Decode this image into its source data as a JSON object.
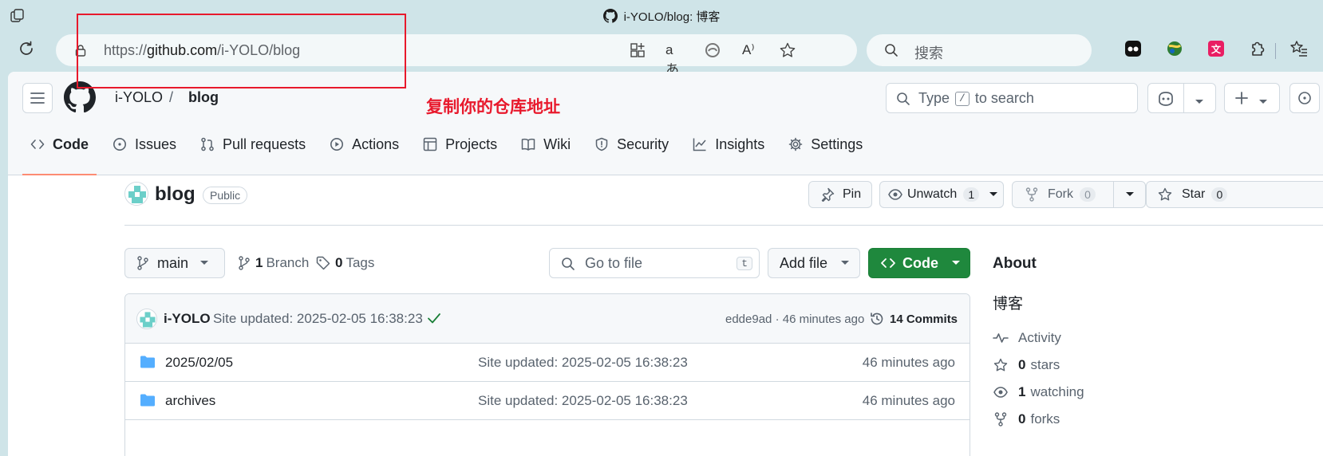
{
  "browser": {
    "window_title": "i-YOLO/blog: 博客",
    "url_prefix": "https://",
    "url_host": "github.com",
    "url_path": "/i-YOLO/blog",
    "search_placeholder": "搜索"
  },
  "annotation": {
    "text": "复制你的仓库地址",
    "color": "#e8192c"
  },
  "header": {
    "owner": "i-YOLO",
    "separator": "/",
    "repo": "blog",
    "search_prefix": "Type",
    "search_key": "/",
    "search_suffix": "to search"
  },
  "nav": {
    "tabs": [
      {
        "label": "Code",
        "icon": "code-icon"
      },
      {
        "label": "Issues",
        "icon": "issue-icon"
      },
      {
        "label": "Pull requests",
        "icon": "pull-request-icon"
      },
      {
        "label": "Actions",
        "icon": "play-icon"
      },
      {
        "label": "Projects",
        "icon": "table-icon"
      },
      {
        "label": "Wiki",
        "icon": "book-icon"
      },
      {
        "label": "Security",
        "icon": "shield-icon"
      },
      {
        "label": "Insights",
        "icon": "graph-icon"
      },
      {
        "label": "Settings",
        "icon": "gear-icon"
      }
    ],
    "active": "Code"
  },
  "repo": {
    "name": "blog",
    "visibility": "Public",
    "pin_label": "Pin",
    "unwatch_label": "Unwatch",
    "watch_count": "1",
    "fork_label": "Fork",
    "fork_count": "0",
    "star_label": "Star",
    "star_count": "0"
  },
  "files": {
    "branch": "main",
    "branch_count": "1",
    "branch_label": "Branch",
    "tag_count": "0",
    "tag_label": "Tags",
    "goto_placeholder": "Go to file",
    "goto_key": "t",
    "add_file_label": "Add file",
    "code_label": "Code",
    "commit": {
      "author": "i-YOLO",
      "message": "Site updated: 2025-02-05 16:38:23",
      "meta": "edde9ad · 46 minutes ago",
      "commits_label": "14 Commits"
    },
    "rows": [
      {
        "name": "2025/02/05",
        "message": "Site updated: 2025-02-05 16:38:23",
        "age": "46 minutes ago"
      },
      {
        "name": "archives",
        "message": "Site updated: 2025-02-05 16:38:23",
        "age": "46 minutes ago"
      }
    ]
  },
  "about": {
    "title": "About",
    "description": "博客",
    "activity": "Activity",
    "stars_count": "0",
    "stars_label": "stars",
    "watching_count": "1",
    "watching_label": "watching",
    "forks_count": "0",
    "forks_label": "forks"
  },
  "colors": {
    "accent_underline": "#fd8c73",
    "code_button": "#1f883d",
    "folder": "#54aeff"
  }
}
